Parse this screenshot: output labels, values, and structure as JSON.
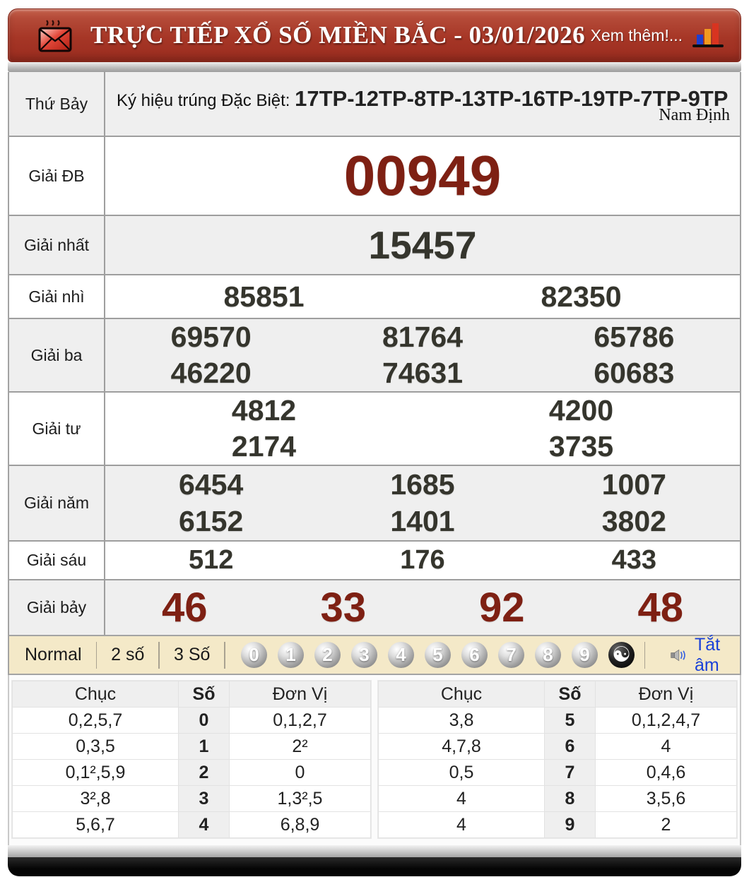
{
  "header": {
    "title": "TRỰC TIẾP XỔ SỐ MIỀN BẮC - 03/01/2026",
    "more_link": "Xem thêm!..."
  },
  "info_row": {
    "day_label": "Thứ Bảy",
    "sign_label": "Ký hiệu trúng Đặc Biệt: ",
    "sign_codes": "17TP-12TP-8TP-13TP-16TP-19TP-7TP-9TP",
    "province": "Nam Định"
  },
  "results": {
    "special": {
      "label": "Giải ĐB",
      "value": "00949"
    },
    "first": {
      "label": "Giải nhất",
      "value": "15457"
    },
    "second": {
      "label": "Giải nhì",
      "values": [
        "85851",
        "82350"
      ]
    },
    "third": {
      "label": "Giải ba",
      "values": [
        "69570",
        "81764",
        "65786",
        "46220",
        "74631",
        "60683"
      ]
    },
    "fourth": {
      "label": "Giải tư",
      "values": [
        "4812",
        "4200",
        "2174",
        "3735"
      ]
    },
    "fifth": {
      "label": "Giải năm",
      "values": [
        "6454",
        "1685",
        "1007",
        "6152",
        "1401",
        "3802"
      ]
    },
    "sixth": {
      "label": "Giải sáu",
      "values": [
        "512",
        "176",
        "433"
      ]
    },
    "seventh": {
      "label": "Giải bảy",
      "values": [
        "46",
        "33",
        "92",
        "48"
      ]
    }
  },
  "controls": {
    "tabs": [
      "Normal",
      "2 số",
      "3 Số"
    ],
    "digit_balls": [
      "0",
      "1",
      "2",
      "3",
      "4",
      "5",
      "6",
      "7",
      "8",
      "9"
    ],
    "yin_yang": "☯",
    "mute_label": "Tắt âm"
  },
  "stats": {
    "left": {
      "headers": [
        "Chục",
        "Số",
        "Đơn Vị"
      ],
      "rows": [
        [
          "0,2,5,7",
          "0",
          "0,1,2,7"
        ],
        [
          "0,3,5",
          "1",
          "2²"
        ],
        [
          "0,1²,5,9",
          "2",
          "0"
        ],
        [
          "3²,8",
          "3",
          "1,3²,5"
        ],
        [
          "5,6,7",
          "4",
          "6,8,9"
        ]
      ]
    },
    "right": {
      "headers": [
        "Chục",
        "Số",
        "Đơn Vị"
      ],
      "rows": [
        [
          "3,8",
          "5",
          "0,1,2,4,7"
        ],
        [
          "4,7,8",
          "6",
          "4"
        ],
        [
          "0,5",
          "7",
          "0,4,6"
        ],
        [
          "4",
          "8",
          "3,5,6"
        ],
        [
          "4",
          "9",
          "2"
        ]
      ]
    }
  },
  "colors": {
    "header_red": "#a63626",
    "special_red": "#7e2013",
    "number_dark": "#35352d",
    "controls_bg": "#f4e9c8",
    "link_blue": "#1a41d8"
  }
}
